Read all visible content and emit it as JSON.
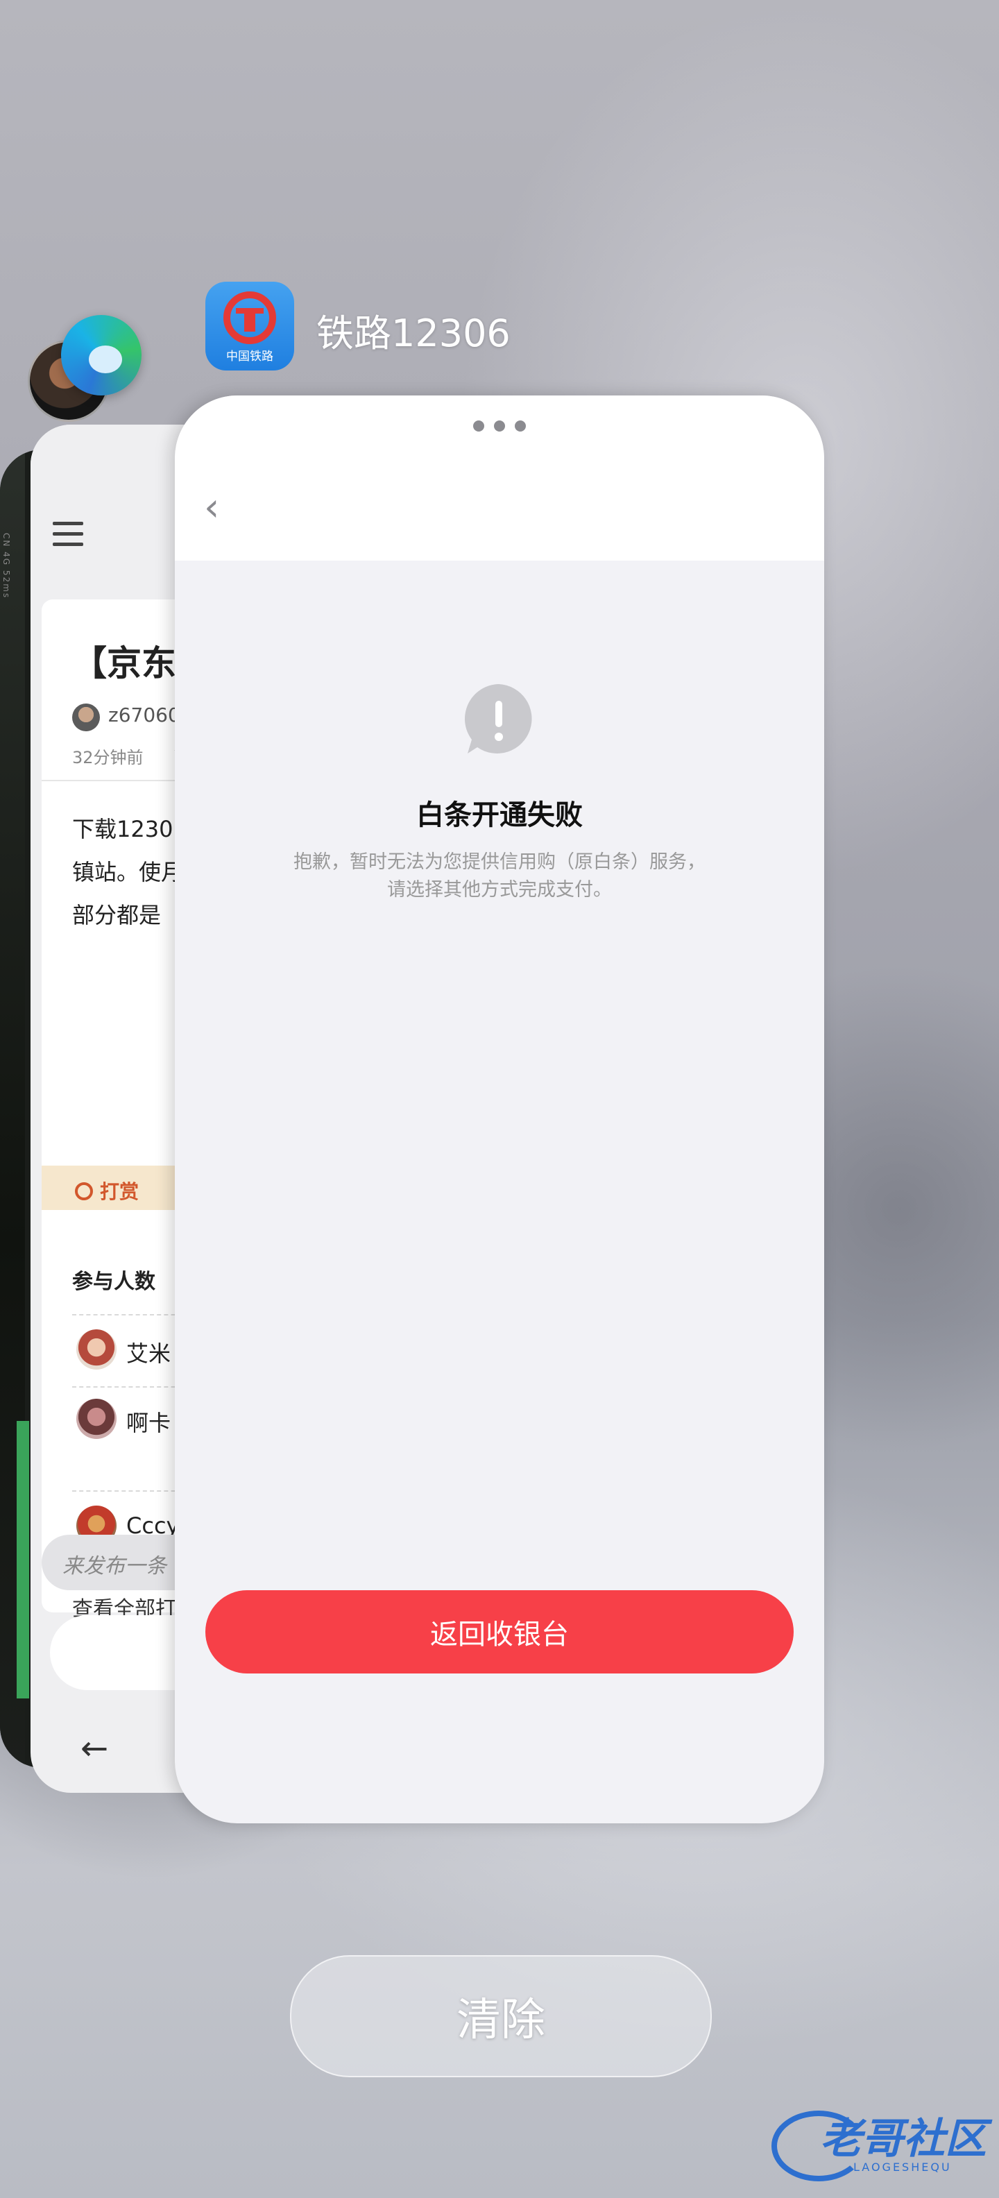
{
  "background_app": {
    "status_text": "CN 4G 52ms"
  },
  "browser_card": {
    "article_title": "【京东",
    "author": "z67060",
    "time": "32分钟前",
    "body_lines": [
      "下载1230",
      "镇站。使月",
      "部分都是"
    ],
    "reward_label": "打赏",
    "participants_label": "参与人数",
    "participants": [
      {
        "name": "艾米"
      },
      {
        "name": "啊卡"
      },
      {
        "name": "Cccy"
      }
    ],
    "view_all": "查看全部打",
    "comment_placeholder": "来发布一条",
    "back_icon": "arrow-left-icon"
  },
  "front_card": {
    "app_name": "铁路12306",
    "app_icon_caption": "中国铁路",
    "menu_icon": "more-dots-icon",
    "back_icon": "chevron-left-icon",
    "alert_icon": "exclamation-bubble-icon",
    "title": "白条开通失败",
    "message_line1": "抱歉，暂时无法为您提供信用购（原白条）服务，",
    "message_line2": "请选择其他方式完成支付。",
    "button_label": "返回收银台",
    "button_color": "#f74048"
  },
  "clear_button_label": "清除",
  "watermark": {
    "text": "老哥社区",
    "sub": "LAOGESHEQU"
  }
}
